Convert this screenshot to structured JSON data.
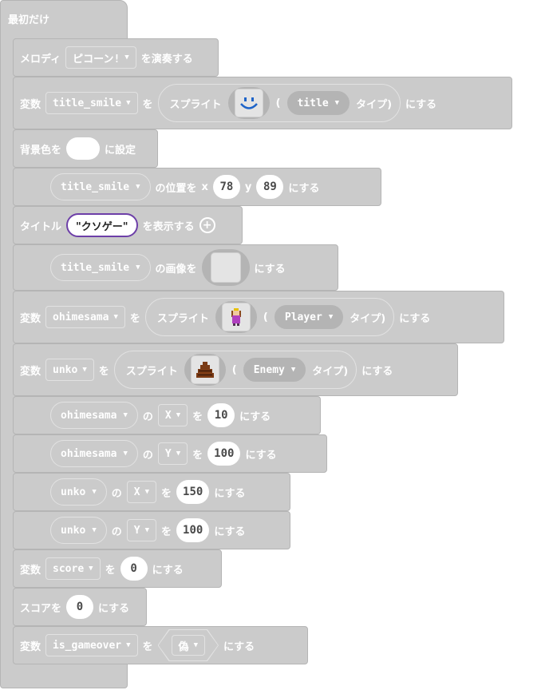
{
  "hat": {
    "label": "最初だけ"
  },
  "melody": {
    "label": "メロディ",
    "value": "ピコーン!",
    "suffix": "を演奏する"
  },
  "var_title": {
    "prefix": "変数",
    "var": "title_smile",
    "wo": "を",
    "sprite": "スプライト",
    "open": "(",
    "type": "title",
    "type_label": "タイプ)",
    "suffix": "にする"
  },
  "bg": {
    "label": "背景色を",
    "suffix": "に設定"
  },
  "pos_title": {
    "var": "title_smile",
    "label": "の位置を",
    "x_label": "x",
    "x": "78",
    "y_label": "y",
    "y": "89",
    "suffix": "にする"
  },
  "title_text": {
    "label": "タイトル",
    "value": "\"クソゲー\"",
    "suffix": "を表示する"
  },
  "img_title": {
    "var": "title_smile",
    "label": "の画像を",
    "suffix": "にする"
  },
  "var_hime": {
    "prefix": "変数",
    "var": "ohimesama",
    "wo": "を",
    "sprite": "スプライト",
    "open": "(",
    "type": "Player",
    "type_label": "タイプ)",
    "suffix": "にする"
  },
  "var_unko": {
    "prefix": "変数",
    "var": "unko",
    "wo": "を",
    "sprite": "スプライト",
    "open": "(",
    "type": "Enemy",
    "type_label": "タイプ)",
    "suffix": "にする"
  },
  "set_rows": [
    {
      "var": "ohimesama",
      "no": "の",
      "axis": "X",
      "wo": "を",
      "value": "10",
      "suffix": "にする"
    },
    {
      "var": "ohimesama",
      "no": "の",
      "axis": "Y",
      "wo": "を",
      "value": "100",
      "suffix": "にする"
    },
    {
      "var": "unko",
      "no": "の",
      "axis": "X",
      "wo": "を",
      "value": "150",
      "suffix": "にする"
    },
    {
      "var": "unko",
      "no": "の",
      "axis": "Y",
      "wo": "を",
      "value": "100",
      "suffix": "にする"
    }
  ],
  "var_score": {
    "prefix": "変数",
    "var": "score",
    "wo": "を",
    "value": "0",
    "suffix": "にする"
  },
  "score_set": {
    "label": "スコアを",
    "value": "0",
    "suffix": "にする"
  },
  "var_gameover": {
    "prefix": "変数",
    "var": "is_gameover",
    "wo": "を",
    "value": "偽",
    "suffix": "にする"
  },
  "colors": {
    "block": "#cbcbcb",
    "border": "#b5b5b5",
    "pill_dark": "#b4b4b4",
    "string_border": "#6d3fa8"
  },
  "icons": [
    "caret-down-icon",
    "add-icon",
    "smile-sprite-icon",
    "princess-sprite-icon",
    "poop-sprite-icon"
  ]
}
